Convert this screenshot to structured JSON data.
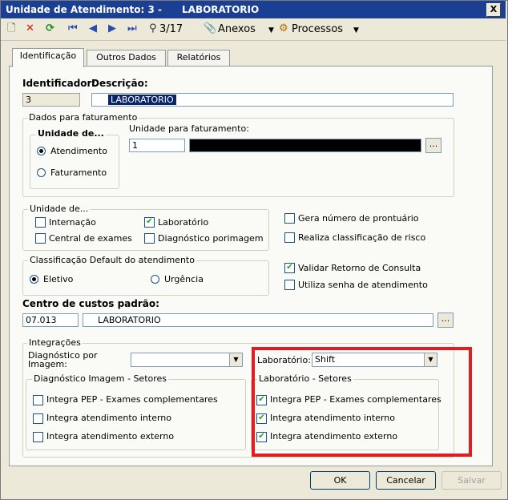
{
  "window": {
    "title": "Unidade de Atendimento: 3 -      LABORATORIO",
    "close_label": "X"
  },
  "toolbar": {
    "record_counter": "3/17",
    "anexos_label": "Anexos",
    "processos_label": "Processos",
    "icons": [
      "new-icon",
      "delete-icon",
      "refresh-icon",
      "first-icon",
      "prev-icon",
      "next-icon",
      "last-icon",
      "binoculars-icon",
      "attach-icon",
      "process-icon"
    ]
  },
  "tabs": [
    "Identificação",
    "Outros Dados",
    "Relatórios"
  ],
  "ident": {
    "identificador_label": "Identificador:",
    "identificador_value": "3",
    "descricao_label": "Descrição:",
    "descricao_value": "LABORATORIO"
  },
  "faturamento": {
    "group_label": "Dados para faturamento",
    "unidade_de_label": "Unidade de...",
    "opt_atendimento": "Atendimento",
    "opt_faturamento": "Faturamento",
    "unidade_faturamento_label": "Unidade para faturamento:",
    "unidade_faturamento_code": "1",
    "dots_label": "..."
  },
  "unidade_de": {
    "group_label": "Unidade de...",
    "internacao": "Internação",
    "laboratorio": "Laboratório",
    "central_exames": "Central de exames",
    "diagnostico_imagem": "Diagnóstico porimagem"
  },
  "right_checks": {
    "gera_numero": "Gera número de prontuário",
    "realiza_classificacao": "Realiza classificação de risco",
    "validar_retorno": "Validar Retorno de Consulta",
    "utiliza_senha": "Utiliza senha de atendimento"
  },
  "classificacao": {
    "group_label": "Classificação Default do atendimento",
    "eletivo": "Eletivo",
    "urgencia": "Urgência"
  },
  "centro_custos": {
    "label": "Centro de custos padrão:",
    "code": "07.013",
    "name": "LABORATORIO",
    "dots_label": "..."
  },
  "integracoes": {
    "group_label": "Integrações",
    "diag_imagem_label": "Diagnóstico por Imagem:",
    "diag_imagem_value": "",
    "laboratorio_label": "Laboratório:",
    "laboratorio_value": "Shift",
    "diag_setores_label": "Diagnóstico Imagem - Setores",
    "lab_setores_label": "Laboratório - Setores",
    "integra_pep": "Integra PEP - Exames complementares",
    "integra_interno": "Integra atendimento interno",
    "integra_externo": "Integra atendimento externo"
  },
  "footer": {
    "ok": "OK",
    "cancelar": "Cancelar",
    "salvar": "Salvar"
  },
  "colors": {
    "titlebar": "#1b3f93",
    "highlight_rect": "#e31b23",
    "selection": "#0a246a"
  }
}
